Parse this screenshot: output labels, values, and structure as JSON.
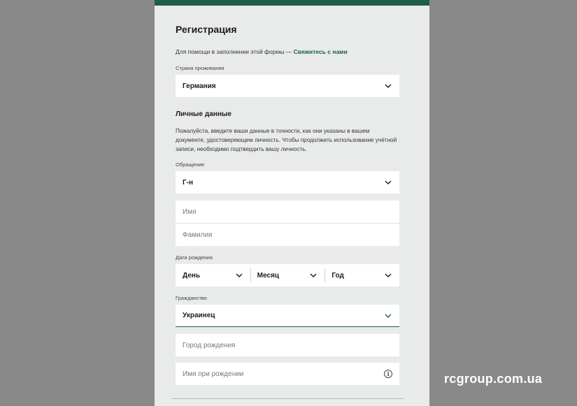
{
  "form": {
    "title": "Регистрация",
    "help_text": "Для помощи в заполнении этой формы — ",
    "help_link": "Свяжитесь с нами",
    "country_label": "Страна проживания",
    "country_value": "Германия",
    "personal_heading": "Личные данные",
    "personal_text": "Пожалуйста, введите ваши данные в точности, как они указаны в вашем документе, удостоверяющем личность. Чтобы продолжить использование учётной записи, необходимо подтвердить вашу личность.",
    "salutation_label": "Обращение",
    "salutation_value": "Г-н",
    "first_name_placeholder": "Имя",
    "last_name_placeholder": "Фамилия",
    "dob_label": "Дата рождения",
    "dob_day": "День",
    "dob_month": "Месяц",
    "dob_year": "Год",
    "citizenship_label": "Гражданство",
    "citizenship_value": "Украинец",
    "birth_city_placeholder": "Город рождения",
    "birth_name_placeholder": "Имя при рождении"
  },
  "watermark": "rcgroup.com.ua",
  "colors": {
    "accent": "#1e6045",
    "panel": "#e9ebea",
    "backdrop": "#898989"
  },
  "icons": {
    "select": "chevron-down-icon",
    "info": "info-icon"
  }
}
